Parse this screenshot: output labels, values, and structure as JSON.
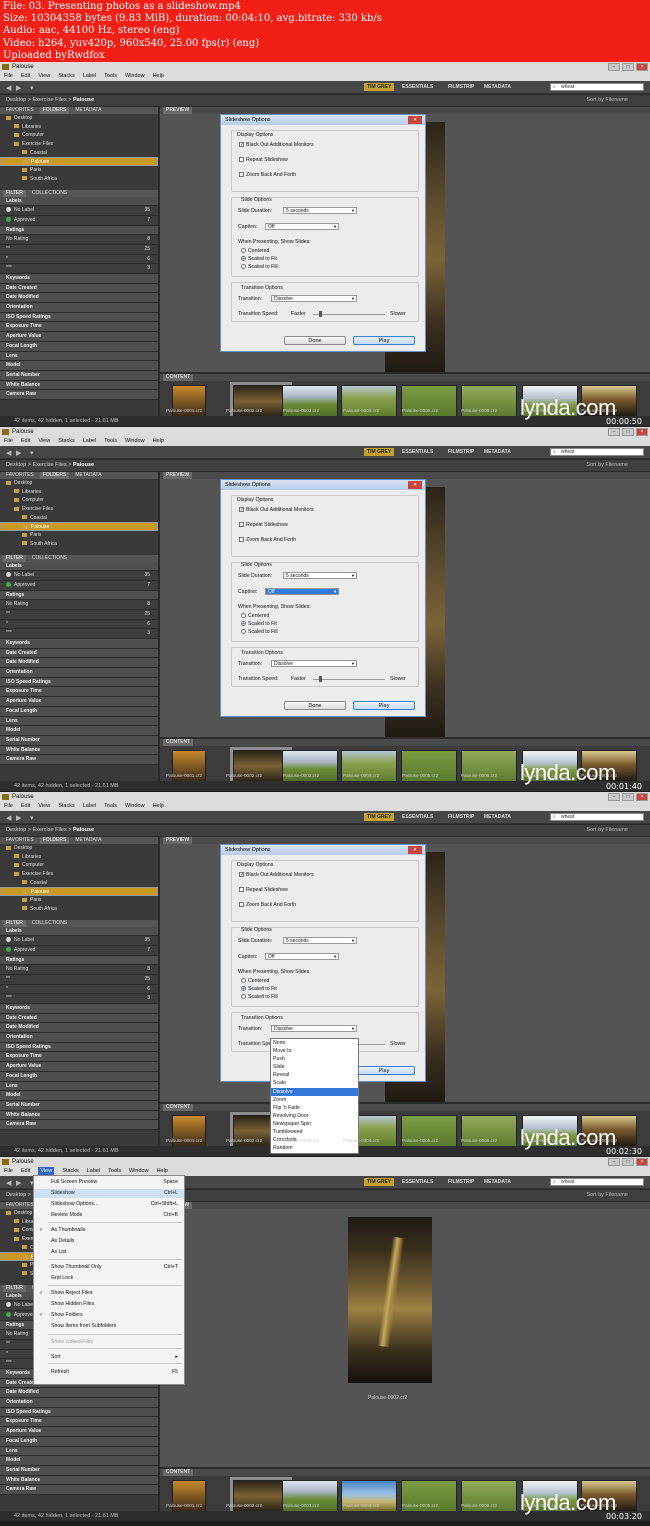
{
  "header": {
    "lines": [
      "File: 03. Presenting photos as a slideshow.mp4",
      "Size: 10304358 bytes (9.83 MiB), duration: 00:04:10, avg.bitrate: 330 kb/s",
      "Audio: aac, 44100 Hz, stereo (eng)",
      "Video: h264, yuv420p, 960x540, 25.00 fps(r) (eng)",
      "Uploaded byRwdfox"
    ]
  },
  "app": {
    "title": "Palouse",
    "menus": [
      "File",
      "Edit",
      "View",
      "Stacks",
      "Label",
      "Tools",
      "Window",
      "Help"
    ],
    "workspaces": [
      "TIM GREY",
      "ESSENTIALS",
      "FILMSTRIP",
      "METADATA"
    ],
    "search_value": "wheat",
    "breadcrumb": [
      "Desktop",
      "Exercise Files",
      "Palouse"
    ],
    "sort_label": "Sort by Filename",
    "panel_tabs": [
      "FAVORITES",
      "FOLDERS",
      "METADATA"
    ],
    "filter_tabs": [
      "FILTER",
      "COLLECTIONS"
    ],
    "preview_tab": "PREVIEW",
    "content_tab": "CONTENT",
    "tree": [
      {
        "label": "Desktop",
        "indent": 0
      },
      {
        "label": "Libraries",
        "indent": 1
      },
      {
        "label": "Computer",
        "indent": 1
      },
      {
        "label": "Exercise Files",
        "indent": 1
      },
      {
        "label": "Coastal",
        "indent": 2
      },
      {
        "label": "Palouse",
        "indent": 2
      },
      {
        "label": "Paris",
        "indent": 2
      },
      {
        "label": "South Africa",
        "indent": 2
      }
    ],
    "filters": {
      "labels_header": "Labels",
      "labels": [
        {
          "name": "No Label",
          "count": "35"
        },
        {
          "name": "Approved",
          "count": "7"
        }
      ],
      "ratings_header": "Ratings",
      "ratings": [
        {
          "name": "No Rating",
          "count": "8"
        },
        {
          "name": "**",
          "count": "25"
        },
        {
          "name": "*",
          "count": "6"
        },
        {
          "name": "***",
          "count": "3"
        }
      ],
      "sections": [
        "Keywords",
        "Date Created",
        "Date Modified",
        "Orientation",
        "ISO Speed Ratings",
        "Exposure Time",
        "Aperture Value",
        "Focal Length",
        "Lens",
        "Model",
        "Serial Number",
        "White Balance",
        "Camera Raw"
      ]
    },
    "thumbnails": [
      "Palouse-0001.cr2",
      "Palouse-0002.cr2",
      "Palouse-0003.cr2",
      "Palouse-0004.cr2",
      "Palouse-0005.cr2",
      "Palouse-0006.cr2",
      "Palouse-0007.cr2",
      "Palouse-0008.cr2"
    ],
    "stars": "★ ★",
    "status": "42 items, 42 hidden, 1 selected - 21.61 MB"
  },
  "dialog": {
    "title": "Slideshow Options",
    "display_options": "Display Options",
    "black_out": "Black Out Additional Monitors",
    "repeat": "Repeat Slideshow",
    "zoom_back": "Zoom Back And Forth",
    "slide_options": "Slide Options",
    "slide_duration_label": "Slide Duration:",
    "slide_duration_value": "5 seconds",
    "caption_label": "Caption:",
    "caption_value": "Off",
    "presenting_label": "When Presenting, Show Slides:",
    "radio_options": [
      "Centered",
      "Scaled to Fit",
      "Scaled to Fill"
    ],
    "transition_options": "Transition Options",
    "transition_label": "Transition:",
    "transition_value": "Dissolve",
    "speed_label": "Transition Speed:",
    "faster": "Faster",
    "slower": "Slower",
    "done": "Done",
    "play": "Play"
  },
  "transition_list": [
    "None",
    "Move In",
    "Push",
    "Slide",
    "Reveal",
    "Scale",
    "Dissolve",
    "Zoom",
    "Flip 'n Fade",
    "Revolving Door",
    "Newspaper Spin",
    "Tumbleweed",
    "Crossfade",
    "Random"
  ],
  "view_menu": {
    "items": [
      {
        "label": "Full Screen Preview",
        "shortcut": "Space"
      },
      {
        "label": "Slideshow",
        "shortcut": "Ctrl+L"
      },
      {
        "label": "Slideshow Options...",
        "shortcut": "Ctrl+Shift+L"
      },
      {
        "label": "Review Mode",
        "shortcut": "Ctrl+B"
      },
      {
        "label": "As Thumbnails",
        "shortcut": ""
      },
      {
        "label": "As Details",
        "shortcut": ""
      },
      {
        "label": "As List",
        "shortcut": ""
      },
      {
        "label": "Show Thumbnail Only",
        "shortcut": "Ctrl+T"
      },
      {
        "label": "Grid Lock",
        "shortcut": ""
      },
      {
        "label": "Show Reject Files",
        "shortcut": ""
      },
      {
        "label": "Show Hidden Files",
        "shortcut": ""
      },
      {
        "label": "Show Folders",
        "shortcut": ""
      },
      {
        "label": "Show Items from Subfolders",
        "shortcut": ""
      },
      {
        "label": "Show Linked Files",
        "shortcut": ""
      },
      {
        "label": "Sort",
        "shortcut": "▸"
      },
      {
        "label": "Refresh",
        "shortcut": "F5"
      }
    ]
  },
  "preview_caption": "Palouse-0002.cr2",
  "watermark": "lynda.com",
  "timestamps": [
    "00:00:50",
    "00:01:40",
    "00:02:30",
    "00:03:20"
  ],
  "colors": {
    "header_red": "#f21f16",
    "accent_gold": "#c7a02c",
    "selection_blue": "#3278d8"
  }
}
